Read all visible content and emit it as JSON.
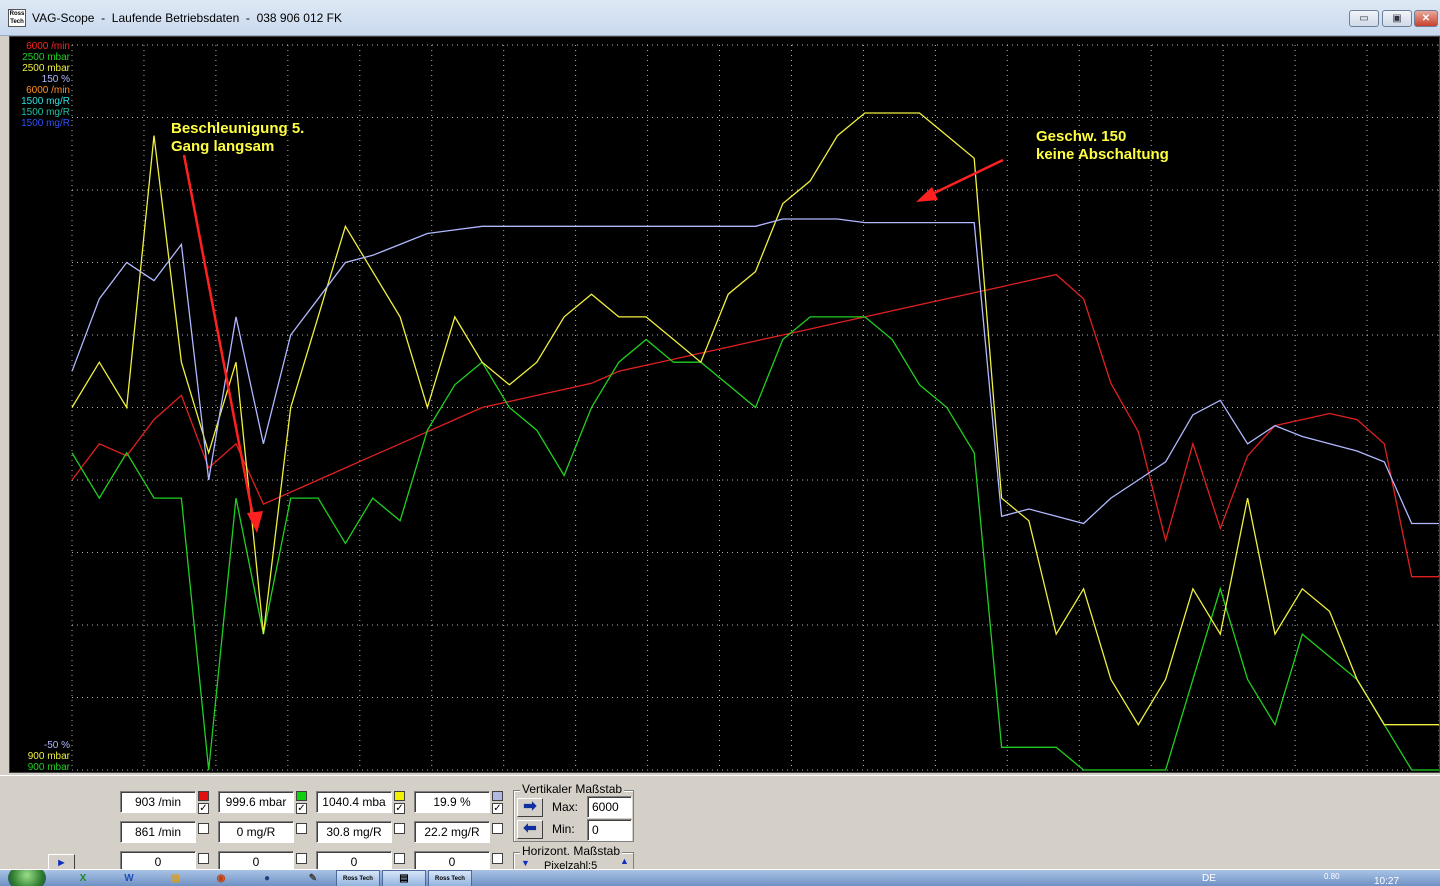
{
  "window": {
    "icon_text": "Ross Tech",
    "title": "VAG-Scope  -  Laufende Betriebsdaten  -  038 906 012 FK",
    "controls": [
      "▭",
      "▣",
      "✕"
    ]
  },
  "colors": {
    "red": "#e02020",
    "green": "#20d020",
    "yellow": "#f0f040",
    "lavender": "#b0b8ff",
    "orange": "#ff9020",
    "cyan": "#30e0e0",
    "teal": "#20c0a0",
    "blue": "#3050ff",
    "grid": "#ffffff",
    "annotation_arrow": "#ff2020"
  },
  "axis_top": [
    {
      "text": "6000 /min",
      "color": "#ff2020"
    },
    {
      "text": "2500 mbar",
      "color": "#20d020"
    },
    {
      "text": "2500 mbar",
      "color": "#f0f040"
    },
    {
      "text": "150 %",
      "color": "#b0b8ff"
    },
    {
      "text": "6000 /min",
      "color": "#ff9020"
    },
    {
      "text": "1500 mg/R",
      "color": "#30e0e0"
    },
    {
      "text": "1500 mg/R",
      "color": "#20c0a0"
    },
    {
      "text": "1500 mg/R",
      "color": "#3050ff"
    }
  ],
  "axis_bottom": [
    {
      "text": "-50 %",
      "color": "#b0b8ff"
    },
    {
      "text": "900 mbar",
      "color": "#f0f040"
    },
    {
      "text": "900 mbar",
      "color": "#20d020"
    }
  ],
  "annotations": {
    "left": "Beschleunigung 5.\nGang langsam",
    "right": "Geschw. 150\nkeine Abschaltung"
  },
  "chart_data": {
    "type": "line",
    "grid": true,
    "x": [
      0,
      2,
      4,
      6,
      8,
      10,
      12,
      14,
      16,
      18,
      20,
      22,
      24,
      26,
      28,
      30,
      32,
      34,
      36,
      38,
      40,
      42,
      44,
      46,
      48,
      50,
      52,
      54,
      56,
      58,
      60,
      62,
      64,
      66,
      68,
      70,
      72,
      74,
      76,
      78,
      80,
      82,
      84,
      86,
      88,
      90,
      92,
      94,
      96,
      98,
      100
    ],
    "series": [
      {
        "color": "#e02020",
        "values": [
          2400,
          2700,
          2600,
          2900,
          3100,
          2500,
          2700,
          2200,
          2300,
          2400,
          2500,
          2600,
          2700,
          2800,
          2900,
          3000,
          3050,
          3100,
          3150,
          3200,
          3300,
          3350,
          3400,
          3450,
          3500,
          3550,
          3600,
          3650,
          3700,
          3750,
          3800,
          3850,
          3900,
          3950,
          4000,
          4050,
          4100,
          3900,
          3200,
          2800,
          1900,
          2700,
          2000,
          2600,
          2850,
          2900,
          2950,
          2900,
          2700,
          1600,
          1600
        ]
      },
      {
        "color": "#20d020",
        "values": [
          1600,
          1500,
          1600,
          1500,
          1500,
          900,
          1500,
          1200,
          1500,
          1500,
          1400,
          1500,
          1450,
          1650,
          1750,
          1800,
          1700,
          1650,
          1550,
          1700,
          1800,
          1850,
          1800,
          1800,
          1750,
          1700,
          1850,
          1900,
          1900,
          1900,
          1850,
          1750,
          1700,
          1600,
          950,
          950,
          950,
          900,
          900,
          900,
          900,
          1100,
          1300,
          1100,
          1000,
          1200,
          1150,
          1100,
          1000,
          900,
          900
        ]
      },
      {
        "color": "#f0f040",
        "values": [
          1700,
          1800,
          1700,
          2300,
          1800,
          1600,
          1800,
          1200,
          1700,
          1900,
          2100,
          2000,
          1900,
          1700,
          1900,
          1800,
          1750,
          1800,
          1900,
          1950,
          1900,
          1900,
          1850,
          1800,
          1950,
          2000,
          2150,
          2200,
          2300,
          2350,
          2350,
          2350,
          2300,
          2250,
          1500,
          1450,
          1200,
          1300,
          1100,
          1000,
          1100,
          1300,
          1200,
          1500,
          1200,
          1300,
          1250,
          1100,
          1000,
          1000,
          1000
        ]
      },
      {
        "color": "#b0b8ff",
        "values": [
          60,
          80,
          90,
          85,
          95,
          30,
          75,
          40,
          70,
          80,
          90,
          92,
          95,
          98,
          99,
          100,
          100,
          100,
          100,
          100,
          100,
          100,
          100,
          100,
          100,
          100,
          102,
          102,
          102,
          101,
          101,
          101,
          101,
          101,
          20,
          22,
          20,
          18,
          25,
          30,
          35,
          48,
          52,
          40,
          45,
          42,
          40,
          38,
          35,
          18,
          18
        ]
      }
    ]
  },
  "readouts": [
    {
      "values": [
        "903 /min",
        "861 /min",
        "0"
      ],
      "color": "#e01010",
      "checked": true
    },
    {
      "values": [
        "999.6 mbar",
        "0 mg/R",
        "0"
      ],
      "color": "#10d010",
      "checked": true
    },
    {
      "values": [
        "1040.4 mba",
        "30.8 mg/R",
        "0"
      ],
      "color": "#f0f000",
      "checked": true
    },
    {
      "values": [
        "19.9 %",
        "22.2 mg/R",
        "0"
      ],
      "color": "#b0b8e0",
      "checked": true
    }
  ],
  "vertical_scale": {
    "title": "Vertikaler Maßstab",
    "max_label": "Max:",
    "max_value": "6000",
    "min_label": "Min:",
    "min_value": "0"
  },
  "horizontal_scale": {
    "title": "Horizont. Maßstab",
    "pixel_label": "Pixelzahl:5"
  },
  "taskbar": {
    "apps": [
      "X",
      "W",
      "▤",
      "◉",
      "✎"
    ],
    "tasks": [
      "Ross Tech",
      "▤",
      "Ross Tech"
    ],
    "lang": "DE",
    "net": "0.80",
    "clock": "10:27"
  }
}
